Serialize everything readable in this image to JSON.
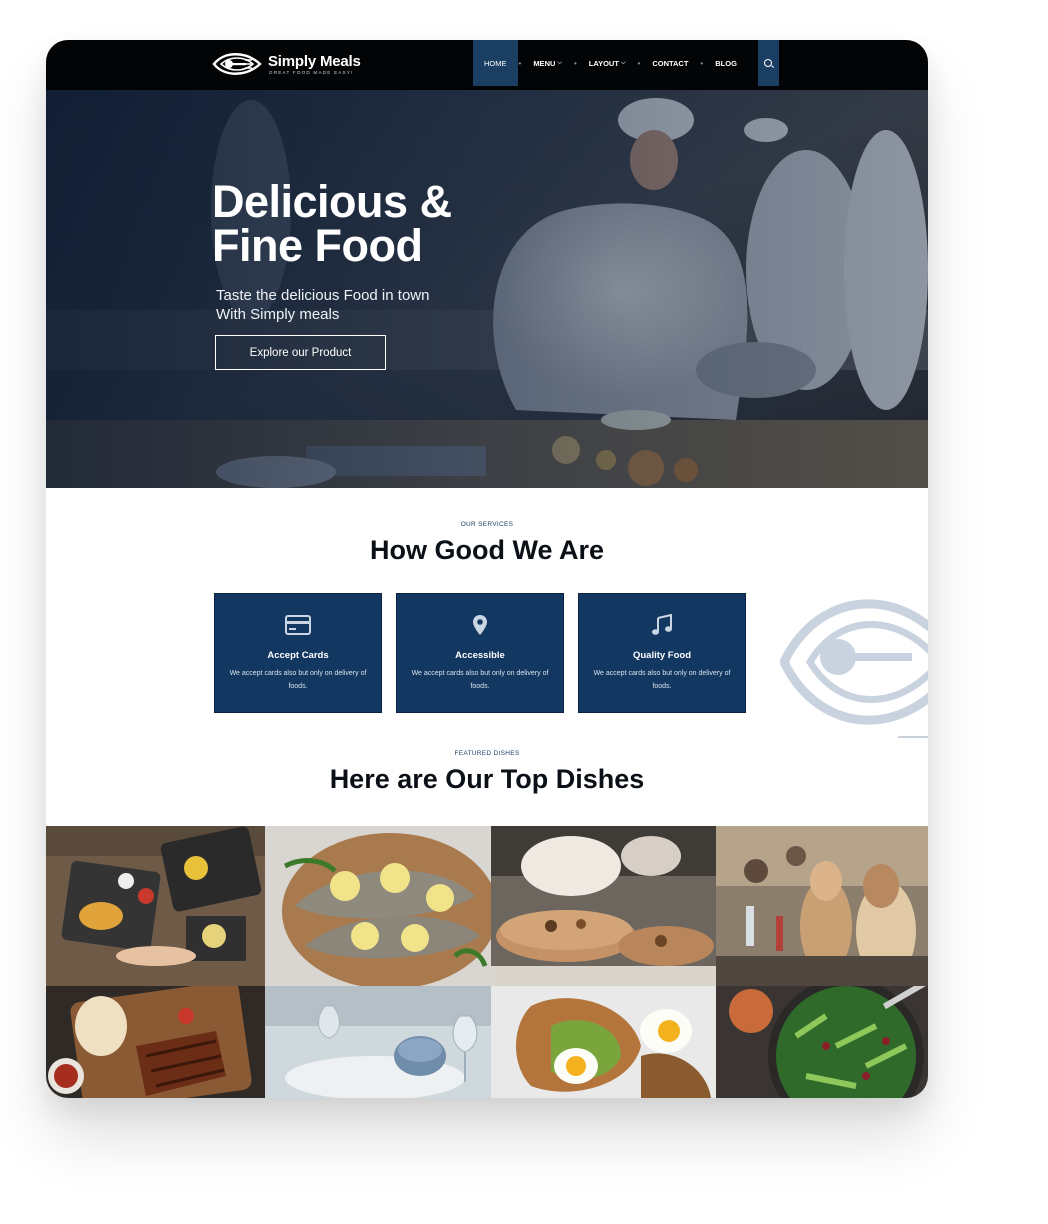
{
  "brand": {
    "name": "Simply Meals",
    "tagline": "GREAT FOOD MADE EASY!"
  },
  "nav": {
    "items": [
      {
        "label": "HOME",
        "active": true,
        "dropdown": false
      },
      {
        "label": "MENU",
        "active": false,
        "dropdown": true
      },
      {
        "label": "LAYOUT",
        "active": false,
        "dropdown": true
      },
      {
        "label": "CONTACT",
        "active": false,
        "dropdown": false
      },
      {
        "label": "BLOG",
        "active": false,
        "dropdown": false
      }
    ],
    "search_icon": "search-icon",
    "separator": "•"
  },
  "hero": {
    "title_line1": "Delicious &",
    "title_line2": "Fine Food",
    "subtitle_line1": "Taste the delicious Food in town",
    "subtitle_line2": "With Simply meals",
    "button_label": "Explore our Product"
  },
  "services": {
    "eyebrow": "OUR SERVICES",
    "title": "How Good We Are",
    "cards": [
      {
        "icon": "credit-card-icon",
        "title": "Accept Cards",
        "text": "We accept cards also but only on delivery of foods."
      },
      {
        "icon": "location-pin-icon",
        "title": "Accessible",
        "text": "We accept cards also but only on delivery of foods."
      },
      {
        "icon": "music-note-icon",
        "title": "Quality Food",
        "text": "We accept cards also but only on delivery of foods."
      }
    ]
  },
  "featured": {
    "eyebrow": "FEATURED DISHES",
    "title": "Here are Our Top Dishes"
  },
  "colors": {
    "nav_bg": "#030405",
    "accent_navy": "#1b3f63",
    "card_bg": "#123760",
    "watermark": "#c9d3df"
  }
}
